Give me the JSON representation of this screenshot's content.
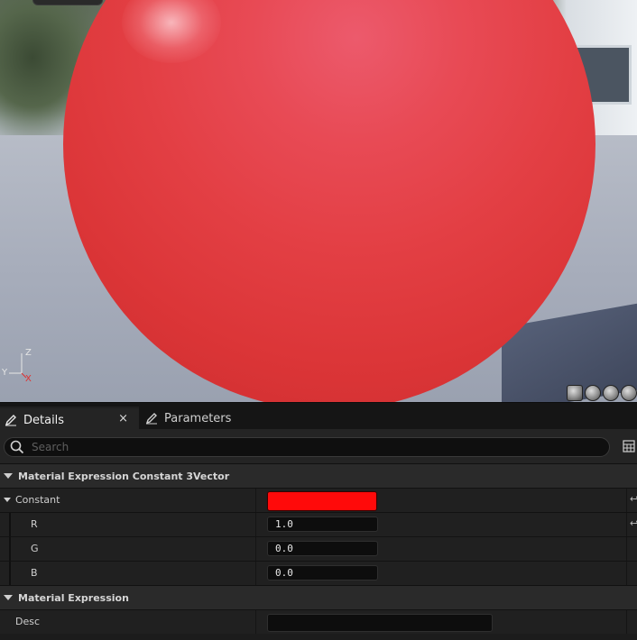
{
  "viewport": {
    "axis_labels": {
      "z": "Z",
      "y": "Y",
      "x": "X"
    },
    "sphere_color": "#e33f44"
  },
  "tabs": [
    {
      "label": "Details",
      "active": true,
      "icon": "pencil-icon",
      "close": "×"
    },
    {
      "label": "Parameters",
      "active": false,
      "icon": "pencil-icon"
    }
  ],
  "search": {
    "placeholder": "Search"
  },
  "categories": [
    {
      "title": "Material Expression Constant 3Vector",
      "rows": [
        {
          "name": "Constant",
          "type": "color",
          "color": "#ff0a0a",
          "reset": "↩"
        },
        {
          "name": "R",
          "value": "1.0",
          "reset": "↩"
        },
        {
          "name": "G",
          "value": "0.0"
        },
        {
          "name": "B",
          "value": "0.0"
        }
      ]
    },
    {
      "title": "Material Expression",
      "rows": [
        {
          "name": "Desc",
          "value": ""
        }
      ]
    }
  ]
}
